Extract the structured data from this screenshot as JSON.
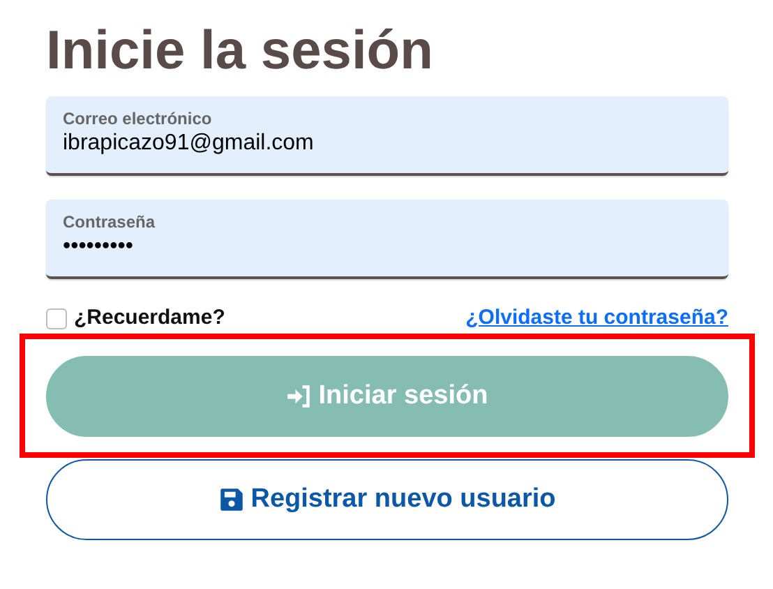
{
  "title": "Inicie la sesión",
  "fields": [
    {
      "label": "Correo electrónico",
      "value": "ibrapicazo91@gmail.com"
    },
    {
      "label": "Contraseña",
      "value": "•••••••••"
    }
  ],
  "remember": {
    "label": "¿Recuerdame?",
    "checked": false
  },
  "forgot_link": "¿Olvidaste tu contraseña?",
  "buttons": [
    {
      "kind": "primary",
      "label": "Iniciar sesión",
      "highlighted": true
    },
    {
      "kind": "outline",
      "label": "Registrar nuevo usuario",
      "highlighted": false
    }
  ]
}
